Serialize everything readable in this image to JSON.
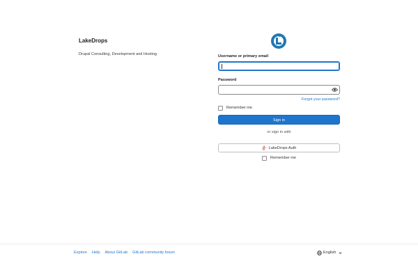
{
  "brand": {
    "title": "LakeDrops",
    "tagline": "Drupal Consulting, Development and Hosting"
  },
  "colors": {
    "accent": "#1f75cb",
    "logo": "#1f78b4",
    "auth_icon": "#e2432a"
  },
  "form": {
    "username_label": "Username or primary email",
    "username_value": "",
    "password_label": "Password",
    "password_value": "",
    "forgot_link": "Forgot your password?",
    "remember_label": "Remember me",
    "sign_in_label": "Sign in",
    "or_text": "or sign in with",
    "auth_button_label": "LakeDrops Auth",
    "auth_remember_label": "Remember me"
  },
  "footer": {
    "links": [
      "Explore",
      "Help",
      "About GitLab",
      "GitLab community forum"
    ],
    "language": "English"
  }
}
